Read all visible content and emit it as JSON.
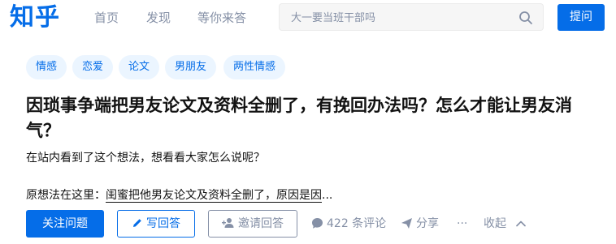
{
  "header": {
    "logo": "知乎",
    "nav": [
      "首页",
      "发现",
      "等你来答"
    ],
    "search_placeholder": "大一要当班干部吗",
    "ask_label": "提问"
  },
  "question": {
    "topics": [
      "情感",
      "恋爱",
      "论文",
      "男朋友",
      "两性情感"
    ],
    "title": "因琐事争端把男友论文及资料全删了，有挽回办法吗？怎么才能让男友消气？",
    "subtitle": "在站内看到了这个想法，想看看大家怎么说呢？",
    "excerpt_prefix": "原想法在这里：",
    "excerpt_link": "闺蜜把他男友论文及资料全删了，原因是因",
    "excerpt_ellipsis": "..."
  },
  "actions": {
    "follow_label": "关注问题",
    "write_label": "写回答",
    "invite_label": "邀请回答",
    "comments_label": "422 条评论",
    "share_label": "分享",
    "more_label": "···",
    "collapse_label": "收起"
  },
  "colors": {
    "brand": "#056de8",
    "muted": "#8590a6",
    "topic_bg": "#ebf5ff"
  },
  "icons": {
    "search": "search-icon",
    "write": "pencil-icon",
    "invite": "add-user-icon",
    "comments": "comment-bubble-icon",
    "share": "paper-plane-icon",
    "collapse": "chevron-up-icon"
  }
}
